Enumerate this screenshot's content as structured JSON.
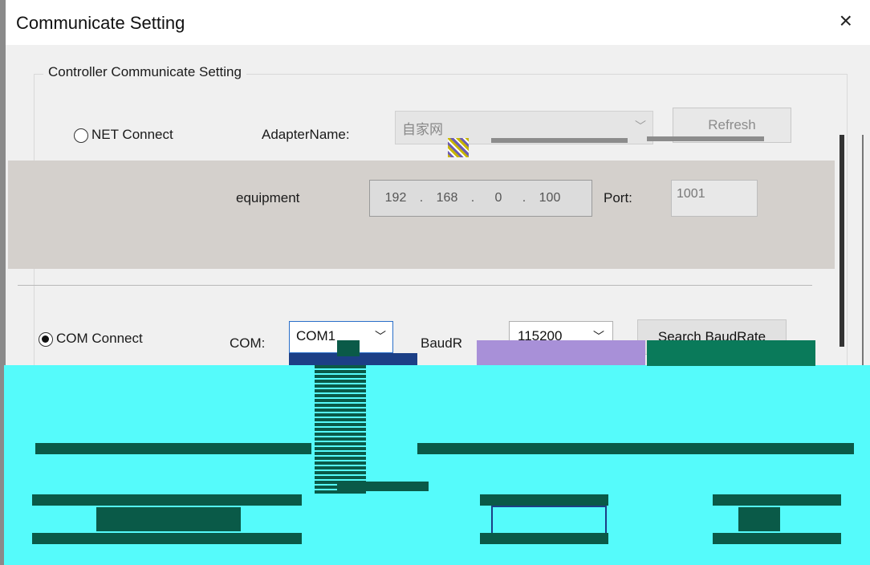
{
  "window": {
    "title": "Communicate Setting",
    "close_glyph": "×"
  },
  "group": {
    "legend": "Controller Communicate Setting"
  },
  "net": {
    "radio_label": "NET Connect",
    "adapter_label": "AdapterName:",
    "adapter_value": "自家网",
    "refresh_label": "Refresh",
    "equipment_label": "equipment",
    "ip": [
      "192",
      "168",
      "0",
      "100"
    ],
    "port_label": "Port:",
    "port_value": "1001"
  },
  "com": {
    "radio_label": "COM Connect",
    "com_label": "COM:",
    "com_value": "COM1",
    "baud_label": "BaudR",
    "baud_value": "115200",
    "search_label": "Search BaudRate"
  },
  "colors": {
    "corrupt_cyan": "#55fbfb",
    "corrupt_dark": "#0a5a48",
    "select_blue": "#2a6fc9"
  }
}
